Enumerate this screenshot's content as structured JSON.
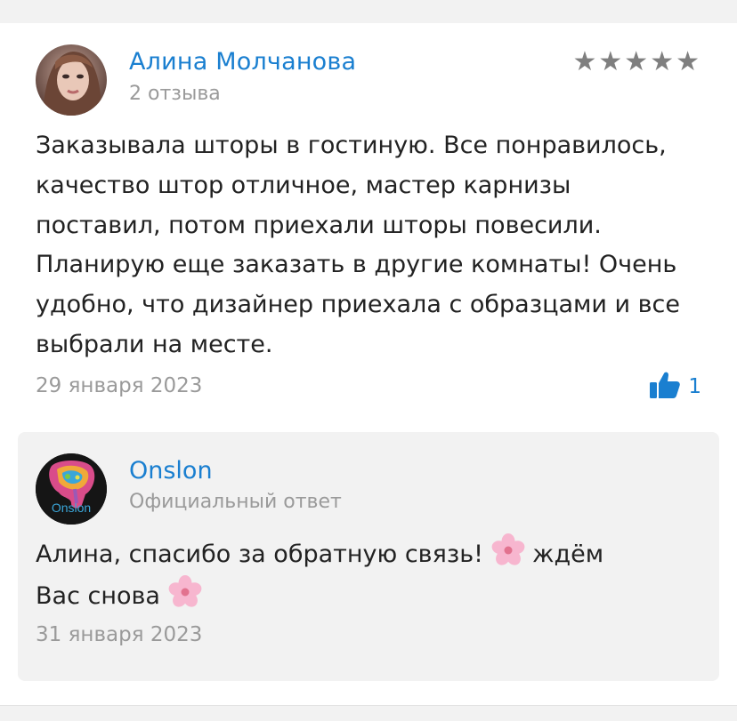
{
  "review": {
    "author": "Алина Молчанова",
    "author_meta": "2 отзыва",
    "stars": "★★★★★",
    "rating": 5,
    "text": "Заказывала шторы в гостиную. Все понравилось, качество штор отличное, мастер карнизы поставил, потом приехали шторы повесили. Планирую еще заказать в другие комнаты! Очень удобно, что дизайнер приехала с образцами и все выбрали на месте.",
    "date": "29 января 2023",
    "likes": "1"
  },
  "reply": {
    "author": "Onslon",
    "author_meta": "Официальный ответ",
    "text_part1": "Алина, спасибо за обратную связь!",
    "text_part2": "ждём",
    "text_part3": "Вас снова",
    "date": "31 января 2023",
    "logo_text": "Onslon"
  },
  "colors": {
    "accent": "#1a7fd0",
    "stars": "#7f7f7f",
    "muted": "#9a9a9a"
  },
  "icons": [
    "thumbs-up-icon",
    "cherry-blossom-emoji"
  ]
}
